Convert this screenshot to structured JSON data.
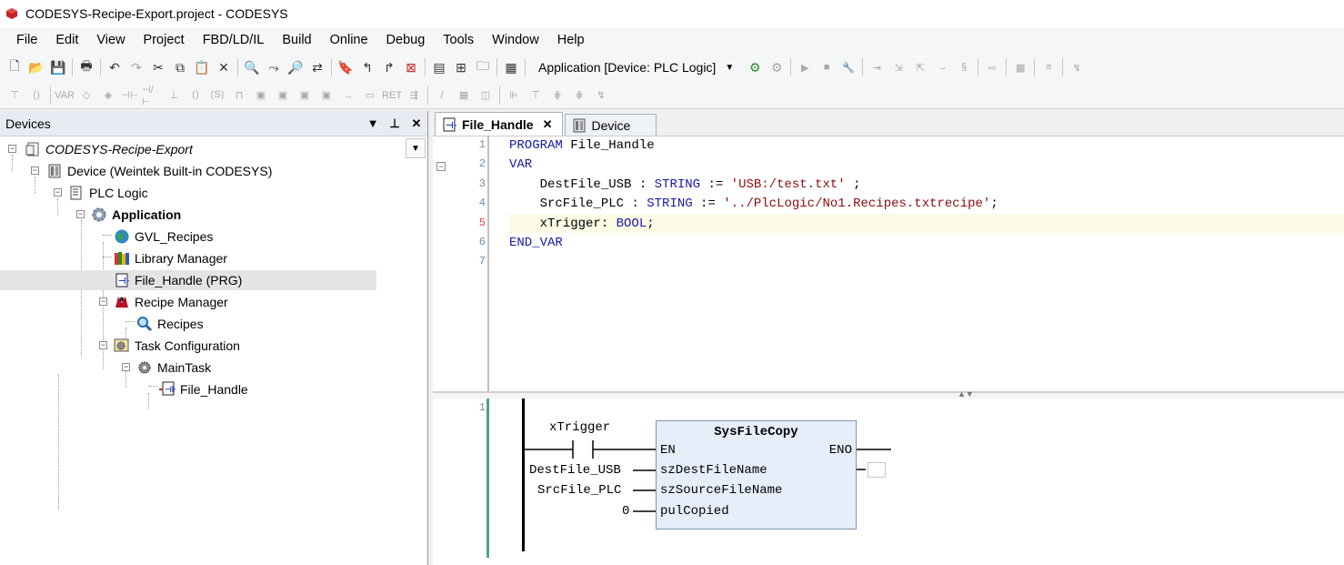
{
  "window": {
    "title": "CODESYS-Recipe-Export.project - CODESYS"
  },
  "menu": [
    "File",
    "Edit",
    "View",
    "Project",
    "FBD/LD/IL",
    "Build",
    "Online",
    "Debug",
    "Tools",
    "Window",
    "Help"
  ],
  "toolbar": {
    "device_combo": "Application [Device: PLC Logic]"
  },
  "devices_panel": {
    "title": "Devices",
    "tree": [
      {
        "label": "CODESYS-Recipe-Export",
        "icon": "project-icon"
      },
      {
        "label": "Device (Weintek Built-in CODESYS)",
        "icon": "device-icon"
      },
      {
        "label": "PLC Logic",
        "icon": "plc-logic-icon"
      },
      {
        "label": "Application",
        "icon": "application-gear-icon"
      },
      {
        "label": "GVL_Recipes",
        "icon": "globe-icon"
      },
      {
        "label": "Library Manager",
        "icon": "library-books-icon"
      },
      {
        "label": "File_Handle (PRG)",
        "icon": "program-icon"
      },
      {
        "label": "Recipe Manager",
        "icon": "recipe-manager-icon"
      },
      {
        "label": "Recipes",
        "icon": "magnifier-icon"
      },
      {
        "label": "Task Configuration",
        "icon": "task-configuration-icon"
      },
      {
        "label": "MainTask",
        "icon": "task-icon"
      },
      {
        "label": "File_Handle",
        "icon": "program-call-icon"
      }
    ]
  },
  "editor": {
    "tabs": [
      {
        "label": "File_Handle",
        "close": "✕",
        "icon": "program-icon"
      },
      {
        "label": "Device",
        "icon": "device-icon"
      }
    ],
    "declaration": {
      "line_numbers": [
        "1",
        "2",
        "3",
        "4",
        "5",
        "6",
        "7"
      ],
      "lines": [
        {
          "parts": [
            [
              "kw",
              "PROGRAM"
            ],
            [
              "",
              " File_Handle"
            ]
          ]
        },
        {
          "parts": [
            [
              "kw",
              "VAR"
            ]
          ]
        },
        {
          "parts": [
            [
              "",
              "    DestFile_USB : "
            ],
            [
              "kw",
              "STRING"
            ],
            [
              "",
              " := "
            ],
            [
              "str",
              "'USB:/test.txt'"
            ],
            [
              "",
              " ;"
            ]
          ]
        },
        {
          "parts": [
            [
              "",
              "    SrcFile_PLC : "
            ],
            [
              "kw",
              "STRING"
            ],
            [
              "",
              " := "
            ],
            [
              "str",
              "'../PlcLogic/No1.Recipes.txtrecipe'"
            ],
            [
              "",
              ";"
            ]
          ]
        },
        {
          "parts": [
            [
              "",
              "    xTrigger: "
            ],
            [
              "kw",
              "BOOL"
            ],
            [
              "",
              ";"
            ]
          ]
        },
        {
          "parts": [
            [
              "kw",
              "END_VAR"
            ]
          ]
        },
        {
          "parts": []
        }
      ]
    },
    "fbd": {
      "network_number": "1",
      "contact_label": "xTrigger",
      "block": {
        "name": "SysFileCopy",
        "inputs": [
          "EN",
          "szDestFileName",
          "szSourceFileName",
          "pulCopied"
        ],
        "outputs": [
          "ENO"
        ]
      },
      "input_values": [
        "DestFile_USB",
        "SrcFile_PLC",
        "0"
      ]
    }
  },
  "colors": {
    "keyword": "#1a1aa6",
    "string": "#8a0c0c",
    "network_bar": "#4aa48a",
    "block_fill": "#e6eefa"
  }
}
